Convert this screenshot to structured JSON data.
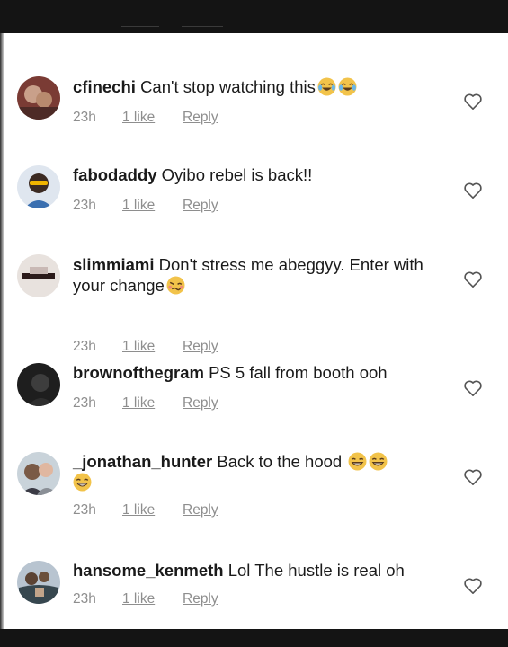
{
  "comments": [
    {
      "username": "cfinechi",
      "text": "Can't stop watching this",
      "emojis": [
        "joy-emoji",
        "joy-emoji"
      ],
      "time": "23h",
      "likes": "1 like",
      "reply": "Reply"
    },
    {
      "username": "fabodaddy",
      "text": "Oyibo rebel is back!!",
      "emojis": [],
      "time": "23h",
      "likes": "1 like",
      "reply": "Reply"
    },
    {
      "username": "slimmiami",
      "text": "Don't stress me abeggyy. Enter with your change",
      "emojis": [
        "woozy-emoji"
      ],
      "time": "23h",
      "likes": "1 like",
      "reply": "Reply"
    },
    {
      "username": "brownofthegram",
      "text": "PS 5 fall from booth ooh",
      "emojis": [],
      "time": "23h",
      "likes": "1 like",
      "reply": "Reply"
    },
    {
      "username": "_jonathan_hunter",
      "text": "Back to the hood",
      "emojis": [
        "grin-emoji",
        "grin-emoji",
        "grin-emoji"
      ],
      "time": "23h",
      "likes": "1 like",
      "reply": "Reply"
    },
    {
      "username": "hansome_kenmeth",
      "text": "Lol The hustle is real oh",
      "emojis": [],
      "time": "23h",
      "likes": "1 like",
      "reply": "Reply"
    }
  ],
  "icons": {
    "like": "heart-outline-icon"
  },
  "colors": {
    "meta": "#8e8e8e",
    "text": "#1a1a1a",
    "background": "#ffffff"
  }
}
